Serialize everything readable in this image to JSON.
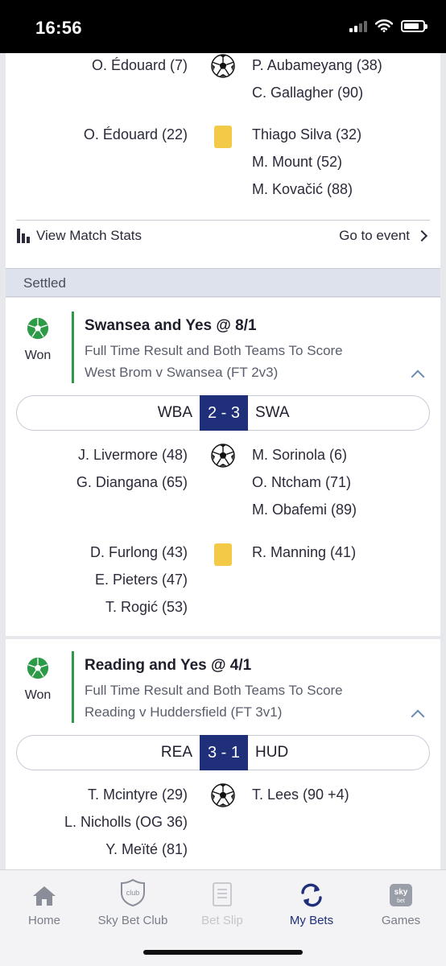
{
  "status_bar": {
    "time": "16:56"
  },
  "top_card": {
    "goals_home": [
      "O. Édouard (7)"
    ],
    "goals_away": [
      "P. Aubameyang (38)",
      "C. Gallagher (90)"
    ],
    "cards_home": [
      "O. Édouard (22)"
    ],
    "cards_away": [
      "Thiago Silva (32)",
      "M. Mount (52)",
      "M. Kovačić (88)"
    ],
    "view_stats_label": "View Match Stats",
    "go_to_event_label": "Go to event"
  },
  "section": {
    "settled_label": "Settled"
  },
  "bets": [
    {
      "status": "Won",
      "title": "Swansea and Yes @ 8/1",
      "market": "Full Time Result and Both Teams To Score",
      "event": "West Brom v Swansea (FT 2v3)",
      "home_abbr": "WBA",
      "score": "2 - 3",
      "away_abbr": "SWA",
      "goals_home": [
        "J. Livermore (48)",
        "G. Diangana (65)"
      ],
      "goals_away": [
        "M. Sorinola (6)",
        "O. Ntcham (71)",
        "M. Obafemi (89)"
      ],
      "cards_home": [
        "D. Furlong (43)",
        "E. Pieters (47)",
        "T. Rogić (53)"
      ],
      "cards_away": [
        "R. Manning (41)"
      ]
    },
    {
      "status": "Won",
      "title": "Reading and Yes @ 4/1",
      "market": "Full Time Result and Both Teams To Score",
      "event": "Reading v Huddersfield (FT 3v1)",
      "home_abbr": "REA",
      "score": "3 - 1",
      "away_abbr": "HUD",
      "goals_home": [
        "T. Mcintyre (29)",
        "L. Nicholls (OG 36)",
        "Y. Meïté (81)"
      ],
      "goals_away": [
        "T. Lees (90 +4)"
      ]
    }
  ],
  "tabbar": {
    "home": "Home",
    "club": "Sky Bet Club",
    "club_badge": "club",
    "betslip": "Bet Slip",
    "mybets": "My Bets",
    "games": "Games",
    "games_badge_top": "sky",
    "games_badge_bottom": "bet"
  },
  "colors": {
    "brand_navy": "#1f2f7a",
    "won_green": "#2d9a47",
    "yellow_card": "#f3c948"
  }
}
